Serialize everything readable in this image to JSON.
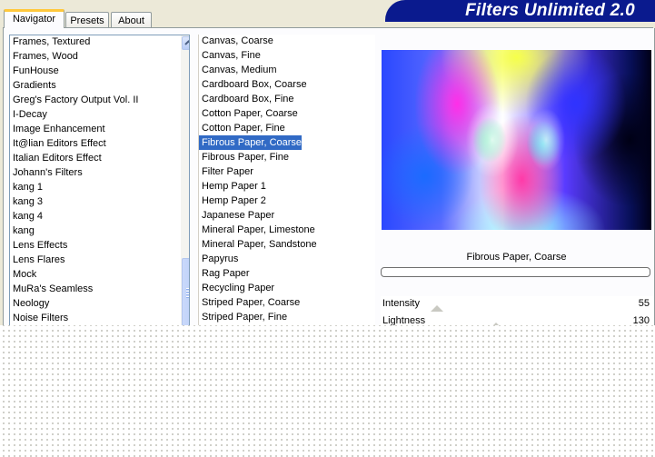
{
  "app": {
    "title": "Filters Unlimited 2.0"
  },
  "tabs": [
    {
      "label": "Navigator",
      "active": true
    },
    {
      "label": "Presets",
      "active": false
    },
    {
      "label": "About",
      "active": false
    }
  ],
  "categories": [
    "Frames, Textured",
    "Frames, Wood",
    "FunHouse",
    "Gradients",
    "Greg's Factory Output Vol. II",
    "I-Decay",
    "Image Enhancement",
    "It@lian Editors Effect",
    "Italian Editors Effect",
    "Johann's Filters",
    "kang 1",
    "kang 3",
    "kang 4",
    "kang",
    "Lens Effects",
    "Lens Flares",
    "Mock",
    "MuRa's Seamless",
    "Neology",
    "Noise Filters"
  ],
  "filters": [
    "Canvas, Coarse",
    "Canvas, Fine",
    "Canvas, Medium",
    "Cardboard Box, Coarse",
    "Cardboard Box, Fine",
    "Cotton Paper, Coarse",
    "Cotton Paper, Fine",
    "Fibrous Paper, Coarse",
    "Fibrous Paper, Fine",
    "Filter Paper",
    "Hemp Paper 1",
    "Hemp Paper 2",
    "Japanese Paper",
    "Mineral Paper, Limestone",
    "Mineral Paper, Sandstone",
    "Papyrus",
    "Rag Paper",
    "Recycling Paper",
    "Striped Paper, Coarse",
    "Striped Paper, Fine"
  ],
  "selected_filter_index": 7,
  "preview": {
    "label": "Fibrous Paper, Coarse"
  },
  "sliders": [
    {
      "name": "Intensity",
      "value": "55"
    },
    {
      "name": "Lightness",
      "value": "130"
    }
  ],
  "colors": {
    "banner": "#0a1a8e",
    "selection": "#316ac5",
    "active_tab_accent": "#ffc83c",
    "window_bg": "#ece9d8"
  }
}
